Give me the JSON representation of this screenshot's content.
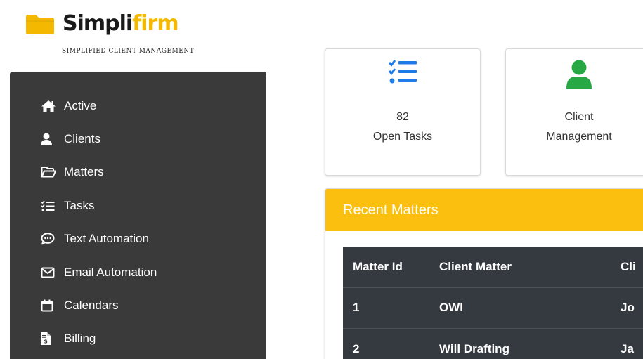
{
  "brand": {
    "name_dark": "Simpli",
    "name_accent": "firm",
    "tagline": "SIMPLIFIED CLIENT MANAGEMENT",
    "folder_color": "#f5b800"
  },
  "sidebar": {
    "items": [
      {
        "label": "Active",
        "icon": "home-icon"
      },
      {
        "label": "Clients",
        "icon": "user-icon"
      },
      {
        "label": "Matters",
        "icon": "folder-open-icon"
      },
      {
        "label": "Tasks",
        "icon": "tasks-icon"
      },
      {
        "label": "Text Automation",
        "icon": "comment-dots-icon"
      },
      {
        "label": "Email Automation",
        "icon": "envelope-icon"
      },
      {
        "label": "Calendars",
        "icon": "calendar-icon"
      },
      {
        "label": "Billing",
        "icon": "invoice-icon"
      }
    ]
  },
  "cards": {
    "tasks": {
      "count": "82",
      "label": "Open Tasks",
      "icon": "tasks-icon",
      "icon_color": "#1e7ce8"
    },
    "clients": {
      "line1": "Client",
      "line2": "Management",
      "icon": "user-icon",
      "icon_color": "#28a745"
    }
  },
  "recent_matters": {
    "title": "Recent Matters",
    "header_color": "#fbbf0f",
    "columns": [
      "Matter Id",
      "Client Matter",
      "Cli"
    ],
    "rows": [
      [
        "1",
        "OWI",
        "Jo"
      ],
      [
        "2",
        "Will Drafting",
        "Ja"
      ]
    ]
  }
}
